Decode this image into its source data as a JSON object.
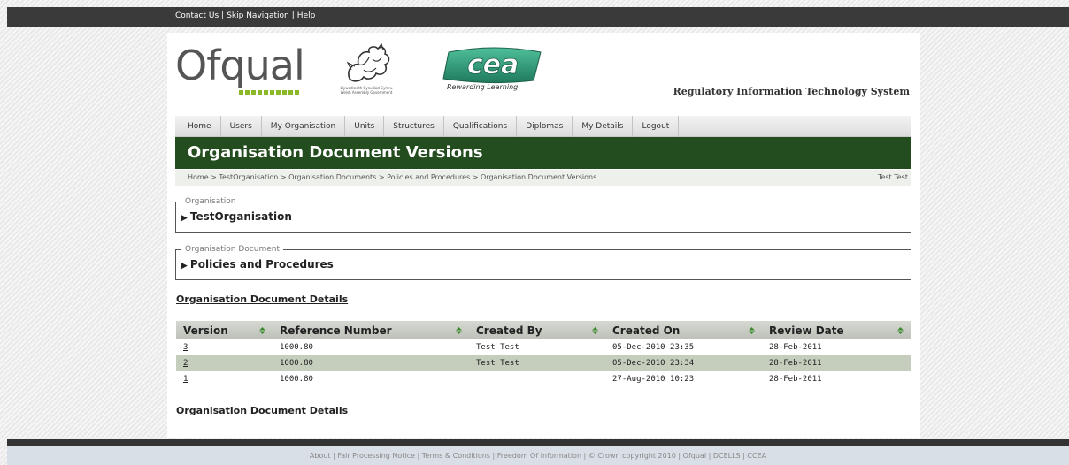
{
  "topbar": {
    "links": [
      "Contact Us",
      "Skip Navigation",
      "Help"
    ]
  },
  "header": {
    "ofqual_logo_text": "Ofqual",
    "welsh_logo_subtext": "Llywodraeth Cynulliad Cymru Welsh Assembly Government",
    "cea_logo_text": "cea",
    "cea_tagline": "Rewarding Learning",
    "system_title": "Regulatory Information Technology System"
  },
  "nav": {
    "items": [
      "Home",
      "Users",
      "My Organisation",
      "Units",
      "Structures",
      "Qualifications",
      "Diplomas",
      "My Details",
      "Logout"
    ]
  },
  "banner": {
    "title": "Organisation Document Versions"
  },
  "breadcrumb": {
    "path": "Home > TestOrganisation > Organisation Documents > Policies and Procedures > Organisation Document Versions",
    "user": "Test Test"
  },
  "organisation": {
    "legend": "Organisation",
    "value": "TestOrganisation"
  },
  "document": {
    "legend": "Organisation Document",
    "value": "Policies and Procedures"
  },
  "details_link_label": "Organisation Document Details",
  "table": {
    "columns": [
      "Version",
      "Reference Number",
      "Created By",
      "Created On",
      "Review Date"
    ],
    "rows": [
      {
        "version": "3",
        "reference": "1000.80",
        "created_by": "Test Test",
        "created_on": "05-Dec-2010 23:35",
        "review_date": "28-Feb-2011"
      },
      {
        "version": "2",
        "reference": "1000.80",
        "created_by": "Test Test",
        "created_on": "05-Dec-2010 23:34",
        "review_date": "28-Feb-2011"
      },
      {
        "version": "1",
        "reference": "1000.80",
        "created_by": "",
        "created_on": "27-Aug-2010 10:23",
        "review_date": "28-Feb-2011"
      }
    ]
  },
  "footer": {
    "text": "About | Fair Processing Notice | Terms & Conditions | Freedom Of Information | © Crown copyright 2010 | Ofqual | DCELLS | CCEA"
  },
  "colors": {
    "banner": "#244d1f",
    "ofqual_dots": "#8ab828",
    "cea_logo": "#2f8f73",
    "alt_row": "#c5cdbd"
  },
  "icons": [
    "dragon-logo-icon",
    "sort-arrow-icon",
    "expand-triangle-icon"
  ]
}
